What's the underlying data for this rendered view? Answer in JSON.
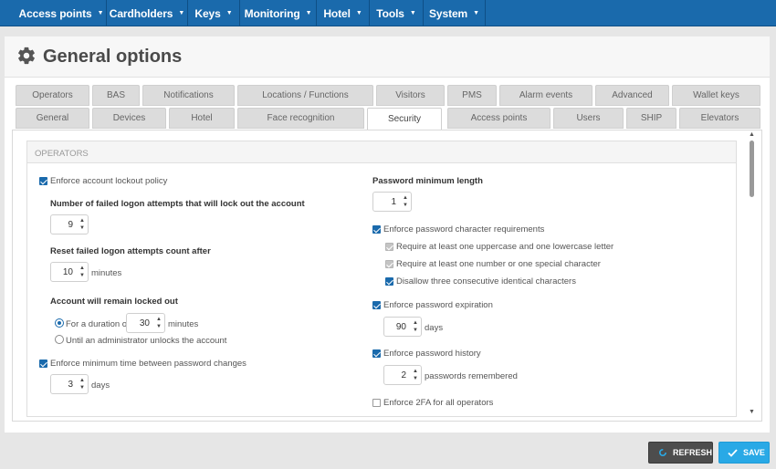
{
  "nav": [
    {
      "label": "Access points"
    },
    {
      "label": "Cardholders"
    },
    {
      "label": "Keys"
    },
    {
      "label": "Monitoring"
    },
    {
      "label": "Hotel"
    },
    {
      "label": "Tools"
    },
    {
      "label": "System"
    }
  ],
  "page": {
    "title": "General options",
    "icon": "gear-icon"
  },
  "tabs_row1": [
    "Operators",
    "BAS",
    "Notifications",
    "Locations / Functions",
    "Visitors",
    "PMS",
    "Alarm events",
    "Advanced",
    "Wallet keys"
  ],
  "tabs_row2": [
    "General",
    "Devices",
    "Hotel",
    "Face recognition",
    "Security",
    "Access points",
    "Users",
    "SHIP",
    "Elevators"
  ],
  "active_tab": "Security",
  "section": {
    "title": "OPERATORS"
  },
  "left": {
    "lockout_policy": {
      "label": "Enforce account lockout policy",
      "checked": true
    },
    "failed_attempts": {
      "label": "Number of failed logon attempts that will lock out the account",
      "value": "9"
    },
    "reset_count": {
      "label": "Reset failed logon attempts count after",
      "value": "10",
      "unit": "minutes"
    },
    "locked_out": {
      "label": "Account will remain locked out"
    },
    "duration": {
      "label": "For a duration of",
      "value": "30",
      "unit": "minutes",
      "selected": true
    },
    "until_admin": {
      "label": "Until an administrator unlocks the account",
      "selected": false
    },
    "min_time": {
      "label": "Enforce minimum time between password changes",
      "checked": true,
      "value": "3",
      "unit": "days"
    }
  },
  "right": {
    "min_length": {
      "label": "Password minimum length",
      "value": "1"
    },
    "char_req": {
      "label": "Enforce password character requirements",
      "checked": true
    },
    "upper_lower": {
      "label": "Require at least one uppercase and one lowercase letter",
      "checked": true
    },
    "number_special": {
      "label": "Require at least one number or one special character",
      "checked": true
    },
    "disallow_three": {
      "label": "Disallow three consecutive identical characters",
      "checked": true
    },
    "expiration": {
      "label": "Enforce password expiration",
      "checked": true,
      "value": "90",
      "unit": "days"
    },
    "history": {
      "label": "Enforce password history",
      "checked": true,
      "value": "2",
      "unit": "passwords remembered"
    },
    "twofa": {
      "label": "Enforce 2FA for all operators",
      "checked": false
    }
  },
  "buttons": {
    "refresh": "REFRESH",
    "save": "SAVE"
  },
  "colors": {
    "nav_bg": "#1a6aac",
    "save_bg": "#29a9e6",
    "refresh_bg": "#4d4d4d"
  }
}
